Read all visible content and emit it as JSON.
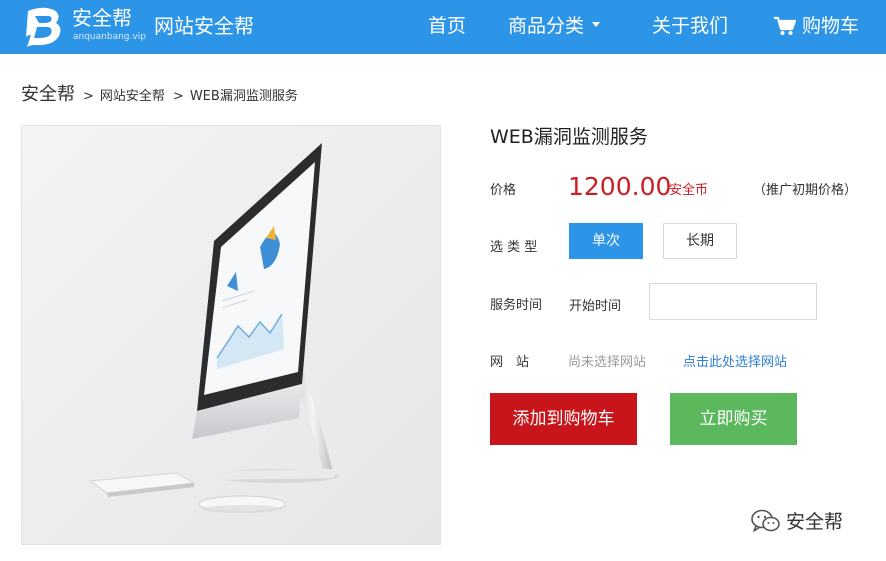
{
  "header": {
    "logo_text": "安全帮",
    "logo_sub": "anquanbang.vip",
    "site_name": "网站安全帮",
    "nav": {
      "home": "首页",
      "category": "商品分类",
      "about": "关于我们",
      "cart": "购物车"
    }
  },
  "breadcrumb": {
    "home": "安全帮",
    "level1": "网站安全帮",
    "level2": "WEB漏洞监测服务"
  },
  "product": {
    "title": "WEB漏洞监测服务",
    "price_label": "价格",
    "price": "1200.00",
    "currency": "安全币",
    "promo_note": "（推广初期价格）",
    "type_label": "选 类 型",
    "type_options": [
      "单次",
      "长期"
    ],
    "type_selected": "单次",
    "time_label": "服务时间",
    "start_time_label": "开始时间",
    "start_time_value": "",
    "site_label": "网　站",
    "site_status": "尚未选择网站",
    "site_choose_link": "点击此处选择网站",
    "add_to_cart": "添加到购物车",
    "buy_now": "立即购买"
  },
  "watermark": "安全帮",
  "colors": {
    "header_bg": "#2d95e8",
    "price": "#cc1e22",
    "add_to_cart": "#c8151c",
    "buy_now": "#5cb85c",
    "link": "#2d7ed8"
  },
  "icons": {
    "logo": "logo-b-icon",
    "caret": "caret-down-icon",
    "cart": "cart-icon",
    "watermark": "wechat-icon"
  }
}
